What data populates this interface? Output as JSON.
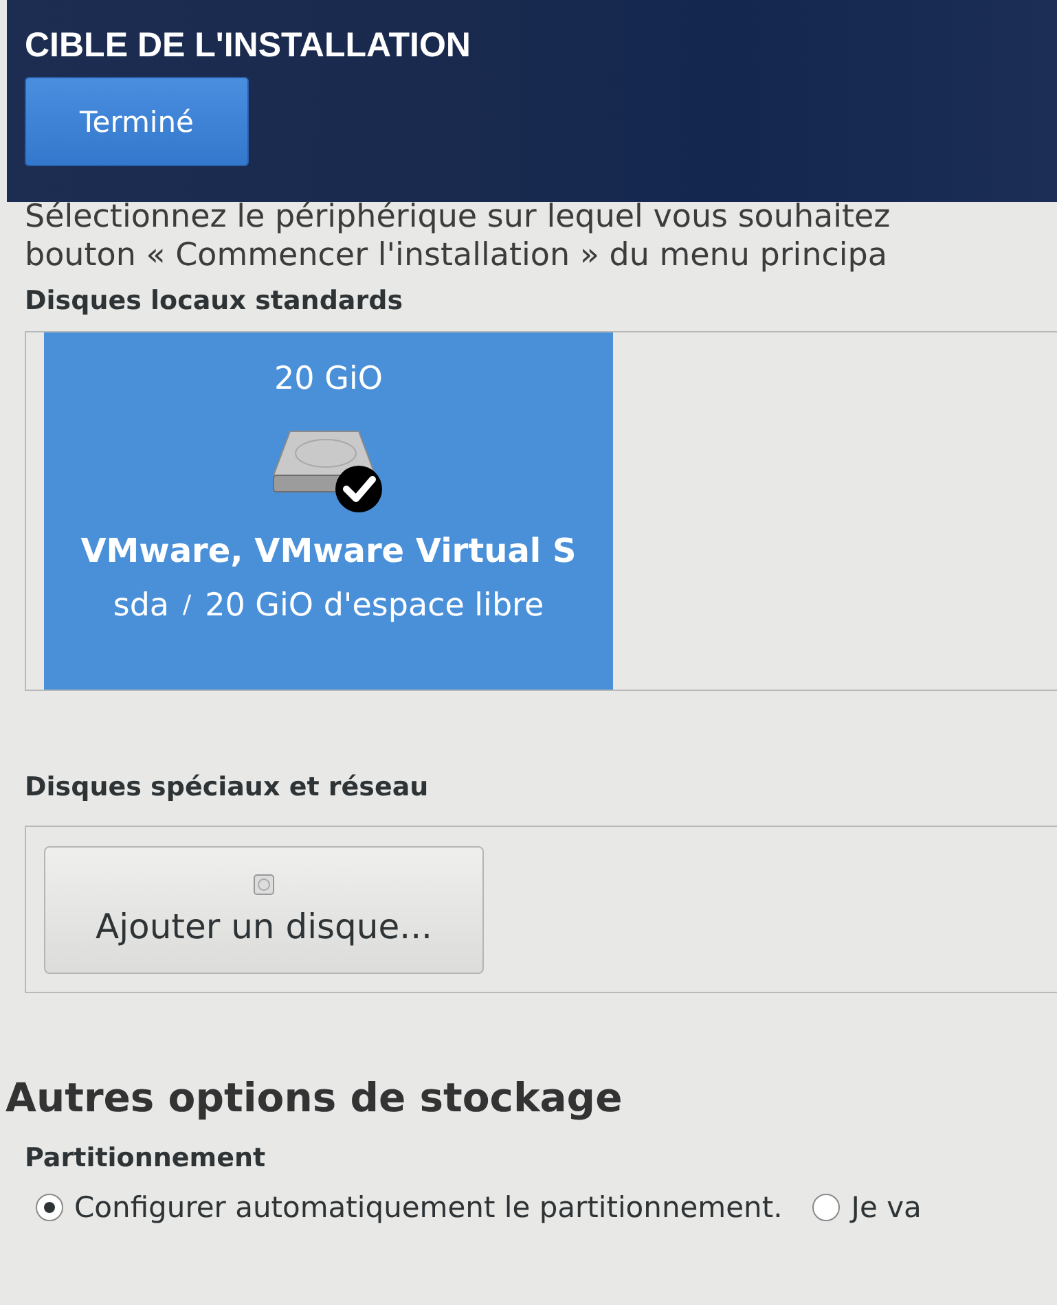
{
  "header": {
    "title": "CIBLE DE L'INSTALLATION",
    "done_button": "Terminé"
  },
  "intro": [
    "Sélectionnez le périphérique sur lequel vous souhaitez",
    "bouton « Commencer l'installation » du menu principa"
  ],
  "local_disks": {
    "heading": "Disques locaux standards",
    "disks": [
      {
        "size": "20 GiO",
        "name": "VMware, VMware Virtual S",
        "device": "sda",
        "separator": "/",
        "free": "20 GiO d'espace libre",
        "selected": true
      }
    ]
  },
  "special_disks": {
    "heading": "Disques spéciaux et réseau",
    "add_button": "Ajouter un disque..."
  },
  "other_options": {
    "heading": "Autres options de stockage",
    "partitioning": {
      "heading": "Partitionnement",
      "options": [
        {
          "label": "Configurer automatiquement le partitionnement.",
          "selected": true
        },
        {
          "label": "Je va",
          "selected": false
        }
      ]
    }
  }
}
